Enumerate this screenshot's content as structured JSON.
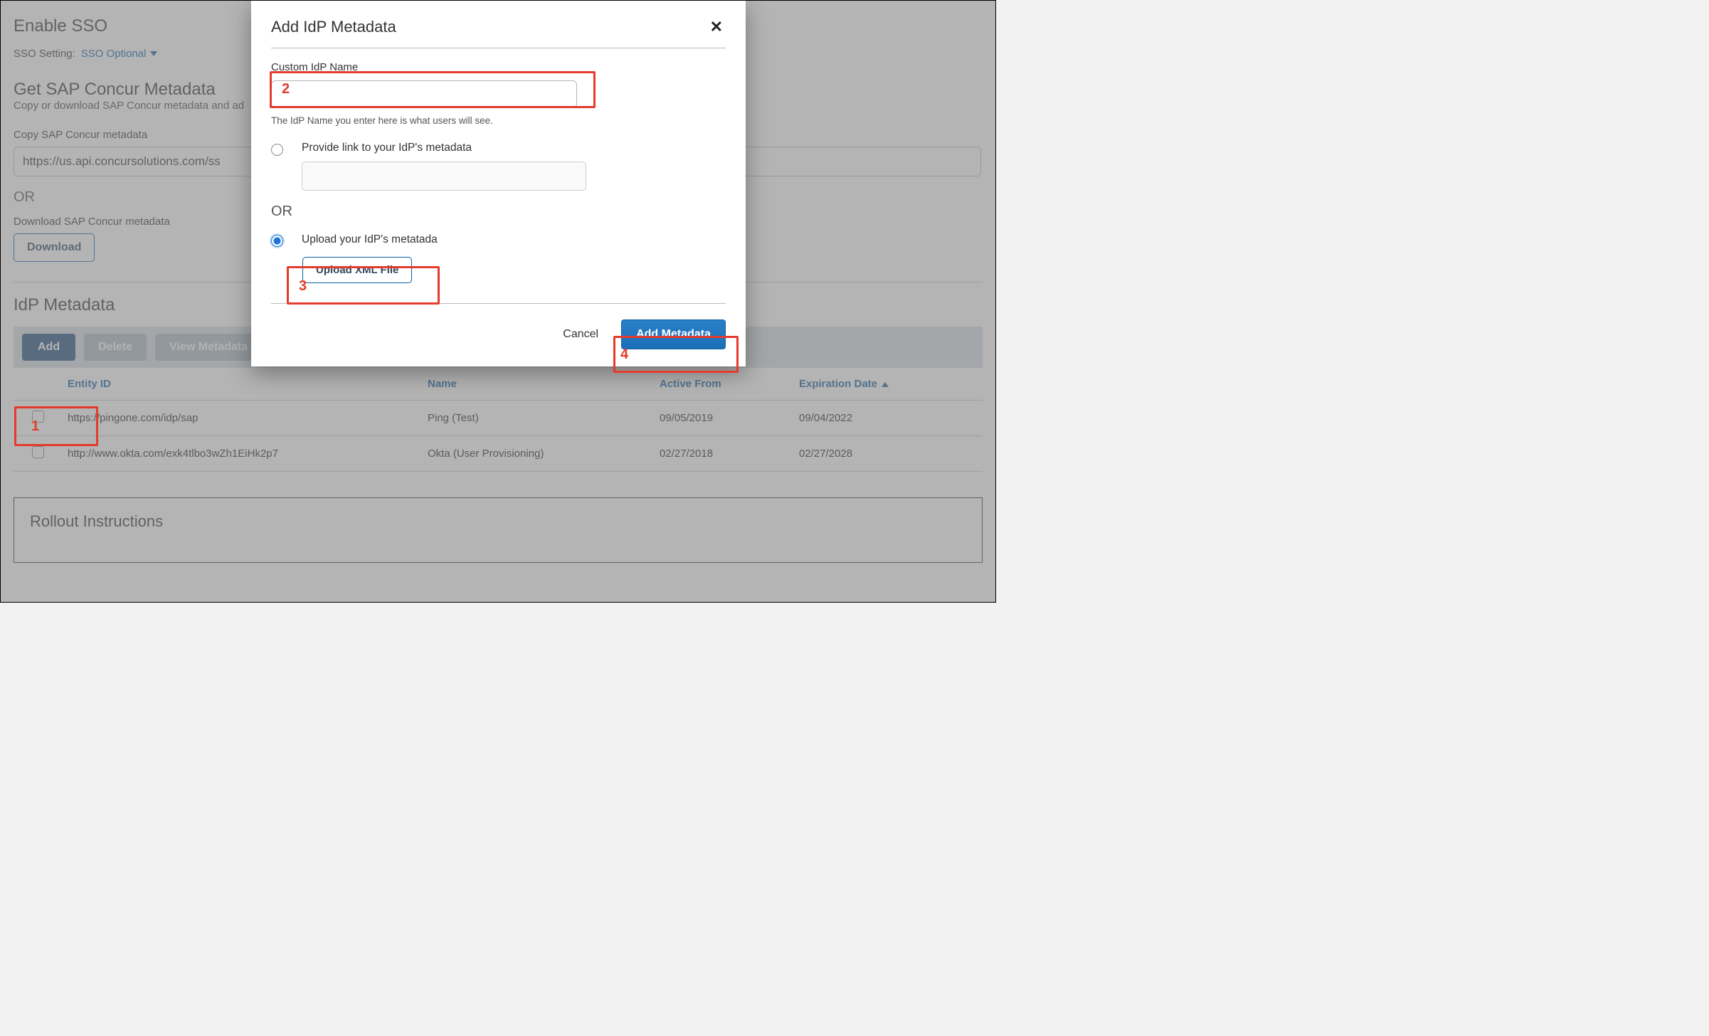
{
  "page": {
    "enable_heading": "Enable SSO",
    "sso_label": "SSO Setting:",
    "sso_value": "SSO Optional",
    "get_meta_heading": "Get SAP Concur Metadata",
    "get_meta_sub": "Copy or download SAP Concur metadata and ad",
    "copy_label": "Copy SAP Concur metadata",
    "metadata_url": "https://us.api.concursolutions.com/ss",
    "or_text": "OR",
    "download_label": "Download SAP Concur metadata",
    "download_btn": "Download",
    "idp_heading": "IdP Metadata",
    "toolbar": {
      "add": "Add",
      "delete": "Delete",
      "view": "View Metadata"
    },
    "table": {
      "cols": {
        "entity": "Entity ID",
        "name": "Name",
        "active": "Active From",
        "exp": "Expiration Date"
      },
      "rows": [
        {
          "entity": "https://pingone.com/idp/sap",
          "name": "Ping (Test)",
          "active": "09/05/2019",
          "exp": "09/04/2022"
        },
        {
          "entity": "http://www.okta.com/exk4tlbo3wZh1EiHk2p7",
          "name": "Okta (User Provisioning)",
          "active": "02/27/2018",
          "exp": "02/27/2028"
        }
      ]
    },
    "rollout_heading": "Rollout Instructions"
  },
  "modal": {
    "title": "Add IdP Metadata",
    "custom_label": "Custom IdP Name",
    "help_text": "The IdP Name you enter here is what users will see.",
    "radio_link_label": "Provide link to your IdP's metadata",
    "or_mid": "OR",
    "radio_upload_label": "Upload your IdP's metatada",
    "upload_btn": "Upload XML File",
    "cancel": "Cancel",
    "add_meta": "Add Metadata"
  },
  "callouts": {
    "n1": "1",
    "n2": "2",
    "n3": "3",
    "n4": "4"
  }
}
